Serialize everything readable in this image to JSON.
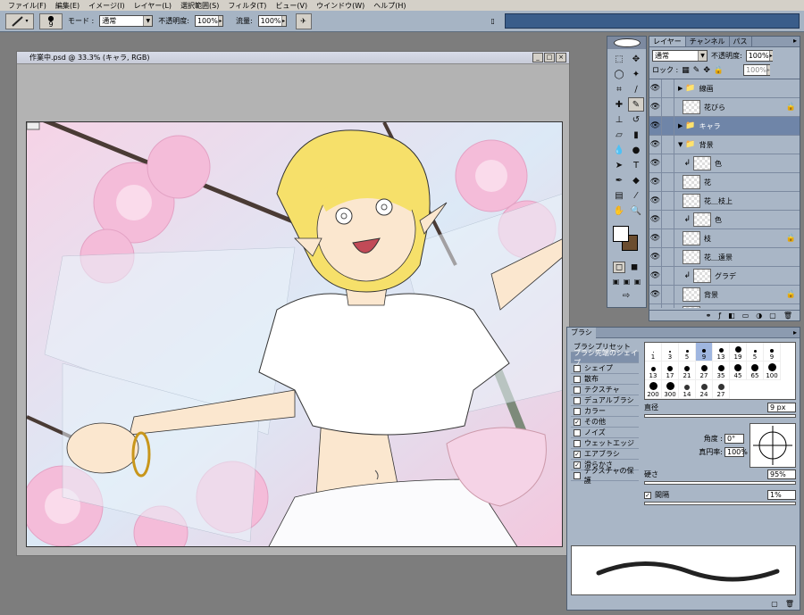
{
  "menubar": [
    "ファイル(F)",
    "編集(E)",
    "イメージ(I)",
    "レイヤー(L)",
    "選択範囲(S)",
    "フィルタ(T)",
    "ビュー(V)",
    "ウインドウ(W)",
    "ヘルプ(H)"
  ],
  "options": {
    "brush_size": "9",
    "mode_label": "モード :",
    "mode_value": "通常",
    "opacity_label": "不透明度:",
    "opacity_value": "100%",
    "flow_label": "流量:",
    "flow_value": "100%"
  },
  "document": {
    "title": "作業中.psd @ 33.3% (キャラ, RGB)"
  },
  "layers": {
    "tabs": [
      "レイヤー",
      "チャンネル",
      "パス"
    ],
    "blend_mode": "通常",
    "opacity_label": "不透明度:",
    "opacity_value": "100%",
    "lock_label": "ロック :",
    "fill_value": "100%",
    "rows": [
      {
        "name": "線画",
        "type": "folder",
        "expanded": false
      },
      {
        "name": "花びら",
        "type": "layer",
        "locked": true
      },
      {
        "name": "キャラ",
        "type": "folder",
        "expanded": false,
        "selected": true
      },
      {
        "name": "背景",
        "type": "folder",
        "expanded": true
      },
      {
        "name": "色",
        "type": "clip"
      },
      {
        "name": "花",
        "type": "layer"
      },
      {
        "name": "花＿枝上",
        "type": "layer"
      },
      {
        "name": "色",
        "type": "clip"
      },
      {
        "name": "枝",
        "type": "layer",
        "locked": true
      },
      {
        "name": "花＿遠景",
        "type": "layer"
      },
      {
        "name": "グラデ",
        "type": "clip"
      },
      {
        "name": "背景",
        "type": "layer",
        "locked": true
      },
      {
        "name": "用紙",
        "type": "layer"
      }
    ]
  },
  "brushes": {
    "title": "ブラシ",
    "preset_label": "ブラシプリセット",
    "tip_label": "ブラシ先端のシェイプ",
    "options": [
      {
        "label": "シェイプ",
        "checked": false
      },
      {
        "label": "散布",
        "checked": false
      },
      {
        "label": "テクスチャ",
        "checked": false
      },
      {
        "label": "デュアルブラシ",
        "checked": false
      },
      {
        "label": "カラー",
        "checked": false
      },
      {
        "label": "その他",
        "checked": true
      },
      {
        "label": "ノイズ",
        "checked": false
      },
      {
        "label": "ウェットエッジ",
        "checked": false
      },
      {
        "label": "エアブラシ",
        "checked": true
      },
      {
        "label": "滑らかさ",
        "checked": true
      },
      {
        "label": "テクスチャの保護",
        "checked": false
      }
    ],
    "grid": [
      "1",
      "3",
      "5",
      "9",
      "13",
      "19",
      "5",
      "9",
      "13",
      "17",
      "21",
      "27",
      "35",
      "45",
      "65",
      "100",
      "200",
      "300",
      "14",
      "24",
      "27"
    ],
    "diameter_label": "直径",
    "diameter_value": "9 px",
    "angle_label": "角度 :",
    "angle_value": "0°",
    "roundness_label": "真円率:",
    "roundness_value": "100%",
    "hardness_label": "硬さ",
    "hardness_value": "95%",
    "spacing_label": "間隔",
    "spacing_value": "1%"
  }
}
